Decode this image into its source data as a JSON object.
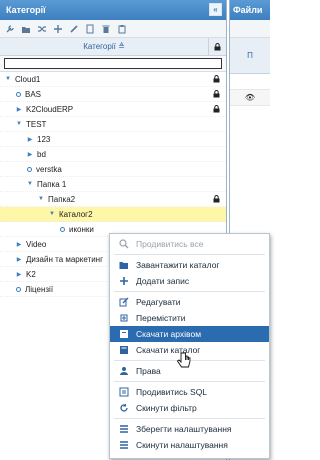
{
  "left_panel": {
    "title": "Категорії",
    "collapse_symbol": "«",
    "column_title": "Категорії",
    "sort_symbol": "≜",
    "filter_value": "",
    "filter_placeholder": ""
  },
  "tree": [
    {
      "label": "Cloud1",
      "level": 0,
      "kind": "open",
      "lock": true
    },
    {
      "label": "BAS",
      "level": 1,
      "kind": "leaf",
      "lock": true
    },
    {
      "label": "K2CloudERP",
      "level": 1,
      "kind": "closed",
      "lock": true
    },
    {
      "label": "TEST",
      "level": 1,
      "kind": "open",
      "lock": false
    },
    {
      "label": "123",
      "level": 2,
      "kind": "closed",
      "lock": false
    },
    {
      "label": "bd",
      "level": 2,
      "kind": "closed",
      "lock": false
    },
    {
      "label": "verstka",
      "level": 2,
      "kind": "leaf",
      "lock": false
    },
    {
      "label": "Папка 1",
      "level": 2,
      "kind": "open",
      "lock": false
    },
    {
      "label": "Папка2",
      "level": 3,
      "kind": "open",
      "lock": true
    },
    {
      "label": "Каталог2",
      "level": 4,
      "kind": "open",
      "lock": false,
      "selected": true
    },
    {
      "label": "иконки",
      "level": 5,
      "kind": "leaf",
      "lock": false
    },
    {
      "label": "Video",
      "level": 1,
      "kind": "closed",
      "lock": false
    },
    {
      "label": "Дизайн та маркетинг",
      "level": 1,
      "kind": "closed",
      "lock": false
    },
    {
      "label": "K2",
      "level": 1,
      "kind": "closed",
      "lock": false
    },
    {
      "label": "Ліцензії",
      "level": 1,
      "kind": "leaf",
      "lock": false
    }
  ],
  "right_panel": {
    "title": "Файли",
    "column_title": "П",
    "eye_symbol": "👁"
  },
  "context_menu": {
    "items": [
      {
        "label": "Продивитись все",
        "icon": "search-icon",
        "disabled": true
      },
      {
        "sep": true
      },
      {
        "label": "Завантажити каталог",
        "icon": "folder-open-icon"
      },
      {
        "label": "Додати запис",
        "icon": "plus-icon"
      },
      {
        "sep": true
      },
      {
        "label": "Редагувати",
        "icon": "edit-icon"
      },
      {
        "label": "Перемістити",
        "icon": "move-icon"
      },
      {
        "label": "Скачати архівом",
        "icon": "archive-icon",
        "hover": true
      },
      {
        "label": "Скачати каталог",
        "icon": "download-icon"
      },
      {
        "sep": true
      },
      {
        "label": "Права",
        "icon": "user-icon"
      },
      {
        "sep": true
      },
      {
        "label": "Продивитись SQL",
        "icon": "sql-icon"
      },
      {
        "label": "Скинути фільтр",
        "icon": "refresh-icon"
      },
      {
        "sep": true
      },
      {
        "label": "Зберегти налаштування",
        "icon": "list-save-icon"
      },
      {
        "label": "Скинути налаштування",
        "icon": "list-reset-icon"
      }
    ]
  },
  "colors": {
    "accent": "#3d7fbf",
    "selected_row": "#fff7a8",
    "menu_hover": "#2b6cb0"
  }
}
